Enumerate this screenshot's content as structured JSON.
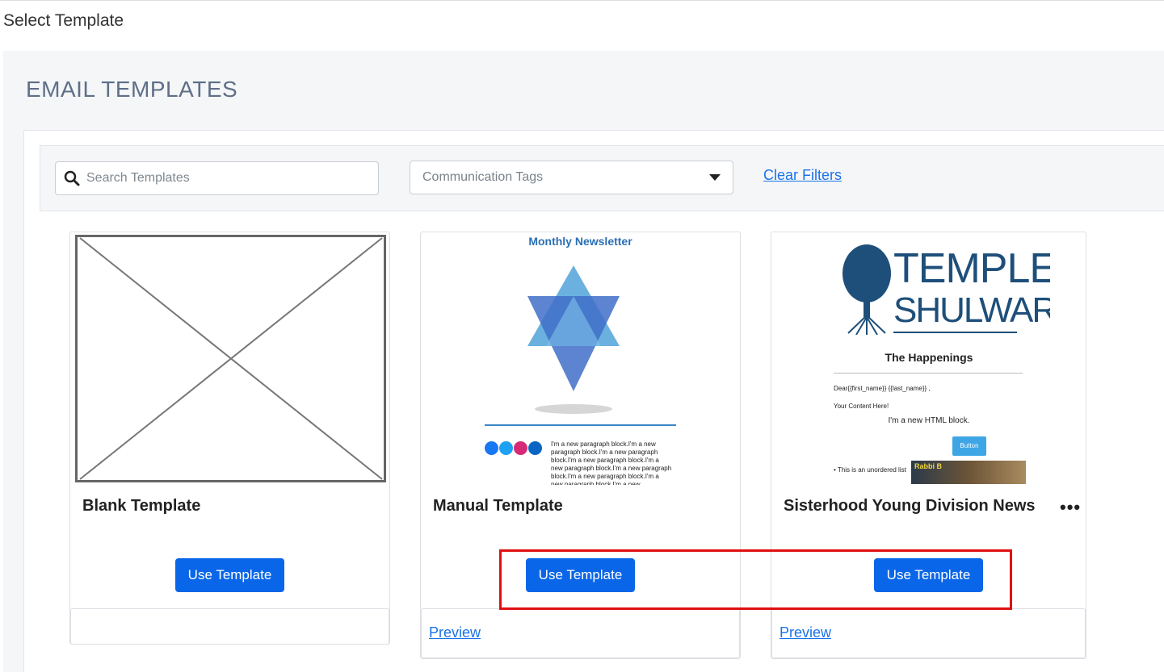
{
  "page": {
    "title": "Select Template"
  },
  "section": {
    "title": "EMAIL TEMPLATES"
  },
  "filters": {
    "search_placeholder": "Search Templates",
    "tags_placeholder": "Communication Tags",
    "clear_label": "Clear Filters"
  },
  "templates": [
    {
      "name": "Blank Template",
      "button_label": "Use Template",
      "preview_label": ""
    },
    {
      "name": "Manual Template",
      "button_label": "Use Template",
      "preview_label": "Preview",
      "thumb": {
        "heading": "Monthly Newsletter",
        "paragraph": "I'm a new paragraph block.I'm a new paragraph block.I'm a new paragraph block.I'm a new paragraph block.I'm a new paragraph block.I'm a new paragraph block.I'm a new paragraph block.I'm a new paragraph block.I'm a new"
      }
    },
    {
      "name": "Sisterhood Young Division News",
      "button_label": "Use Template",
      "preview_label": "Preview",
      "more_label": "•••",
      "thumb": {
        "logo_line1": "TEMPLE",
        "logo_line2": "SHULWARE",
        "heading": "The Happenings",
        "greeting": "Dear{{first_name}}  {{last_name}} ,",
        "content": "Your Content Here!",
        "html_block": "I'm a new HTML block.",
        "button": "Button",
        "list_item": "This is an unordered list",
        "image_caption": "Rabbi B"
      }
    }
  ],
  "colors": {
    "accent": "#0a66e8",
    "link": "#1a73e8",
    "highlight": "#e01010"
  }
}
